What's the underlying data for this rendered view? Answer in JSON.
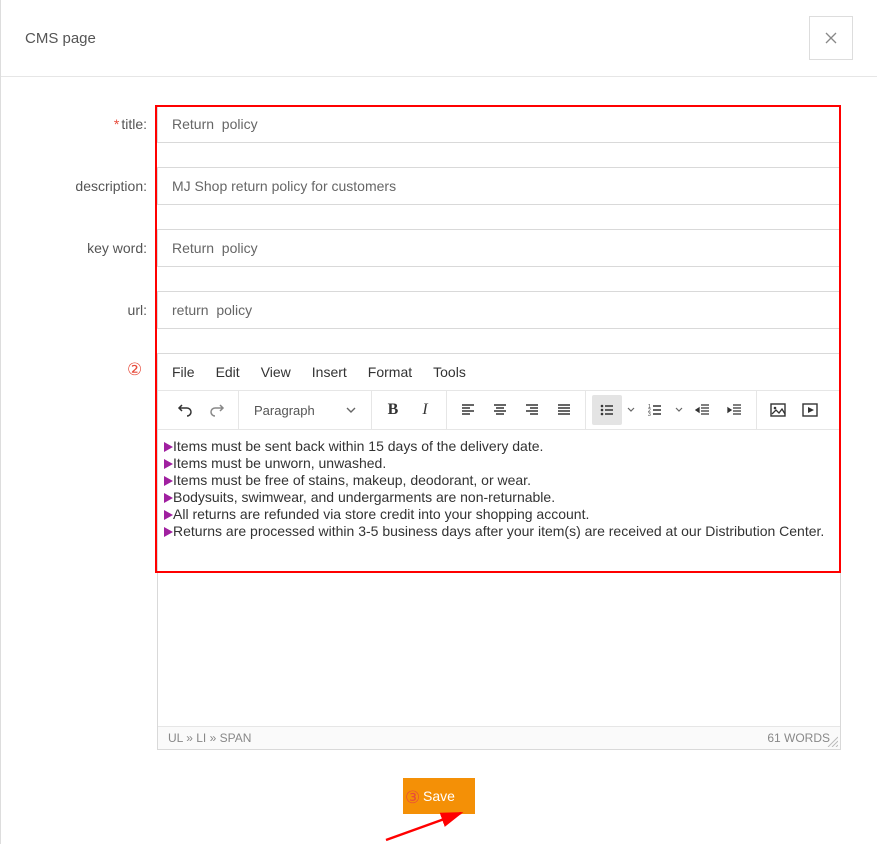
{
  "modal": {
    "title": "CMS page"
  },
  "form": {
    "labels": {
      "title": "title:",
      "description": "description:",
      "keyword": "key word:",
      "url": "url:"
    },
    "title_value": "Return  policy",
    "description_value": "MJ Shop return policy for customers",
    "keyword_value": "Return  policy",
    "url_value": "return  policy"
  },
  "editor": {
    "menus": {
      "file": "File",
      "edit": "Edit",
      "view": "View",
      "insert": "Insert",
      "format": "Format",
      "tools": "Tools"
    },
    "paragraph_label": "Paragraph",
    "lines": [
      "Items must be sent back within 15 days of the delivery date.",
      "Items must be unworn, unwashed.",
      "Items must be free of stains, makeup, deodorant, or wear.",
      "Bodysuits, swimwear, and undergarments are non-returnable.",
      "All returns are refunded via store credit into your shopping account.",
      "Returns are processed within 3-5 business days after your item(s) are received at our Distribution Center."
    ],
    "statusbar_path": "UL » LI » SPAN",
    "word_count": "61 WORDS"
  },
  "footer": {
    "save": "Save"
  },
  "callouts": {
    "two": "②",
    "three": "③"
  }
}
